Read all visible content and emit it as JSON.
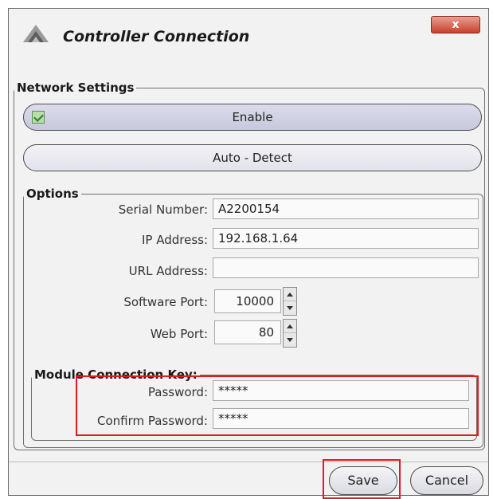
{
  "window": {
    "title": "Controller Connection",
    "close_label": "x"
  },
  "network": {
    "legend": "Network Settings",
    "enable_label": "Enable",
    "enable_checked": true,
    "auto_detect_label": "Auto - Detect"
  },
  "options": {
    "legend": "Options",
    "serial_label": "Serial Number:",
    "serial_value": "A2200154",
    "ip_label": "IP Address:",
    "ip_value": "192.168.1.64",
    "url_label": "URL Address:",
    "url_value": "",
    "software_port_label": "Software Port:",
    "software_port_value": "10000",
    "web_port_label": "Web Port:",
    "web_port_value": "80"
  },
  "module": {
    "legend": "Module Connection Key:",
    "password_label": "Password:",
    "password_value": "*****",
    "confirm_label": "Confirm Password:",
    "confirm_value": "*****"
  },
  "footer": {
    "save_label": "Save",
    "cancel_label": "Cancel"
  },
  "colors": {
    "highlight_red": "#e11b22",
    "close_button": "#c8402c",
    "enable_fill": "#c8c8dc"
  },
  "icons": {
    "app": "triangle-logo-icon",
    "enable_check": "checkbox-checked-icon"
  }
}
